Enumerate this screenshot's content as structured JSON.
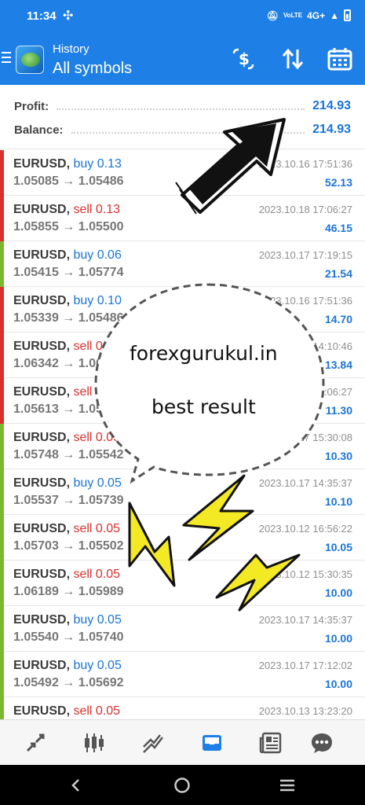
{
  "status_bar": {
    "time": "11:34",
    "network": "4G+"
  },
  "header": {
    "subtitle": "History",
    "title": "All symbols"
  },
  "summary": {
    "profit_label": "Profit:",
    "profit_value": "214.93",
    "balance_label": "Balance:",
    "balance_value": "214.93"
  },
  "colors": {
    "accent": "#1e80e6",
    "buy": "#1a74d6",
    "sell": "#d9302c",
    "profit_bar": "#7cb82f",
    "loss_bar": "#d9302c"
  },
  "trades": [
    {
      "symbol": "EURUSD,",
      "dir": "buy 0.13",
      "type": "buy",
      "prices": "1.05085 → 1.05486",
      "date": "2023.10.16 17:51:36",
      "profit": "52.13"
    },
    {
      "symbol": "EURUSD,",
      "dir": "sell 0.13",
      "type": "sell",
      "prices": "1.05855 → 1.05500",
      "date": "2023.10.18 17:06:27",
      "profit": "46.15"
    },
    {
      "symbol": "EURUSD,",
      "dir": "buy 0.06",
      "type": "buy",
      "prices": "1.05415 → 1.05774",
      "date": "2023.10.17 17:19:15",
      "profit": "21.54"
    },
    {
      "symbol": "EURUSD,",
      "dir": "buy 0.10",
      "type": "buy",
      "prices": "1.05339 → 1.05486",
      "date": "2023.10.16 17:51:36",
      "profit": "14.70"
    },
    {
      "symbol": "EURUSD,",
      "dir": "sell 0.06",
      "type": "sell",
      "prices": "1.06342 → 1.06112",
      "date": "2023.10.18 14:10:46",
      "profit": "13.84"
    },
    {
      "symbol": "EURUSD,",
      "dir": "sell 0.05",
      "type": "sell",
      "prices": "1.05613 → 1.05387",
      "date": "2023.10.18 17:06:27",
      "profit": "11.30"
    },
    {
      "symbol": "EURUSD,",
      "dir": "sell 0.05",
      "type": "sell",
      "prices": "1.05748 → 1.05542",
      "date": "2023.10.17 15:30:08",
      "profit": "10.30"
    },
    {
      "symbol": "EURUSD,",
      "dir": "buy 0.05",
      "type": "buy",
      "prices": "1.05537 → 1.05739",
      "date": "2023.10.17 14:35:37",
      "profit": "10.10"
    },
    {
      "symbol": "EURUSD,",
      "dir": "sell 0.05",
      "type": "sell",
      "prices": "1.05703 → 1.05502",
      "date": "2023.10.12 16:56:22",
      "profit": "10.05"
    },
    {
      "symbol": "EURUSD,",
      "dir": "sell 0.05",
      "type": "sell",
      "prices": "1.06189 → 1.05989",
      "date": "2023.10.12 15:30:35",
      "profit": "10.00"
    },
    {
      "symbol": "EURUSD,",
      "dir": "buy 0.05",
      "type": "buy",
      "prices": "1.05540 → 1.05740",
      "date": "2023.10.17 14:35:37",
      "profit": "10.00"
    },
    {
      "symbol": "EURUSD,",
      "dir": "buy 0.05",
      "type": "buy",
      "prices": "1.05492 → 1.05692",
      "date": "2023.10.17 17:12:02",
      "profit": "10.00"
    },
    {
      "symbol": "EURUSD,",
      "dir": "sell 0.05",
      "type": "sell",
      "prices": "",
      "date": "2023.10.13 13:23:20",
      "profit": ""
    }
  ],
  "overlay": {
    "line1": "forexgurukul.in",
    "line2": "best result"
  },
  "bottom_nav": [
    "quotes-icon",
    "chart-icon",
    "trade-icon",
    "history-icon",
    "news-icon",
    "chat-icon"
  ]
}
